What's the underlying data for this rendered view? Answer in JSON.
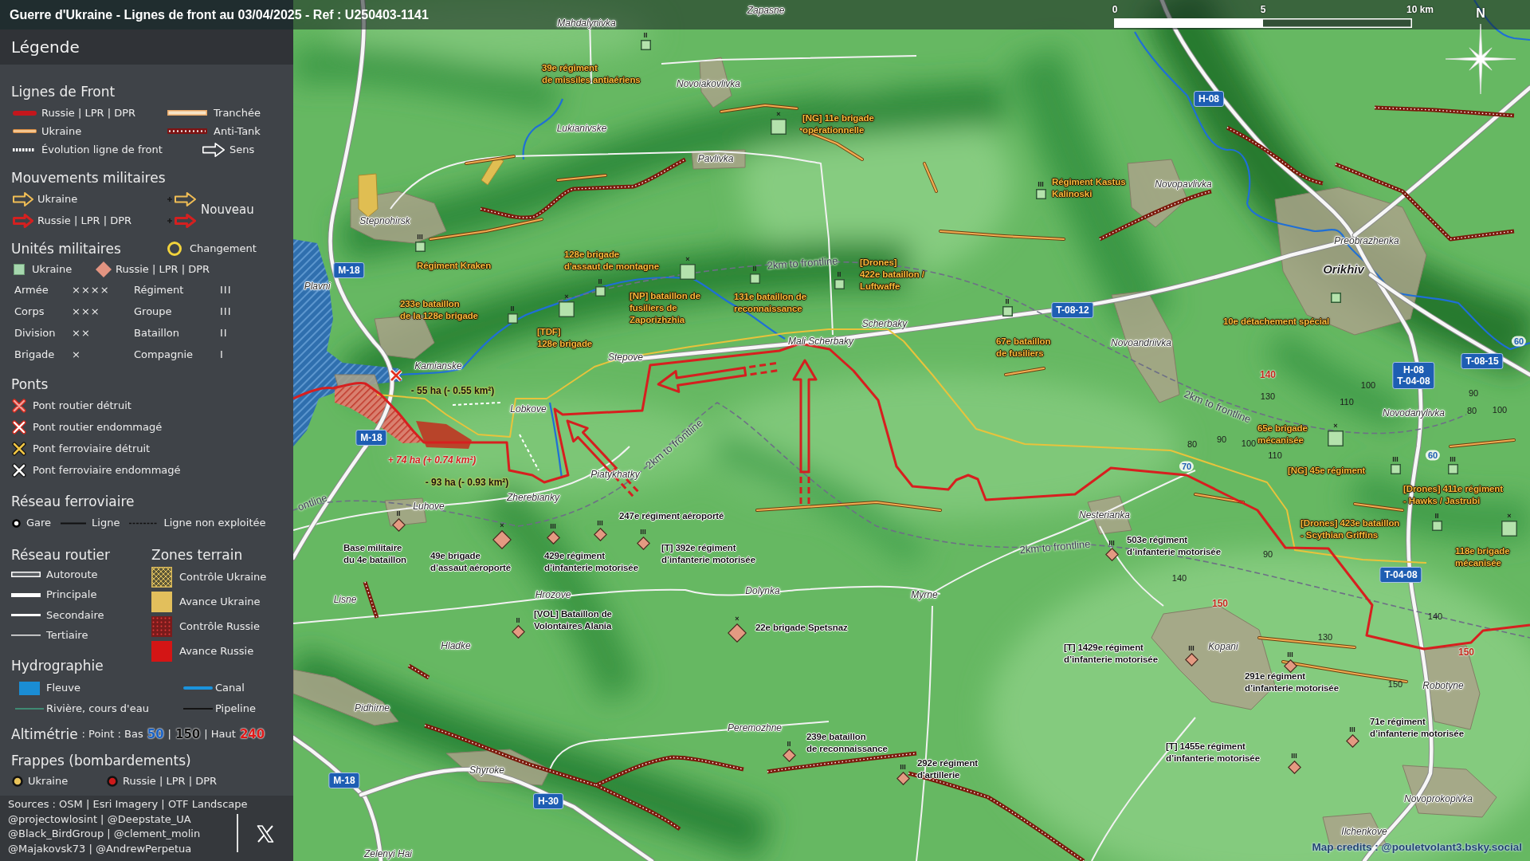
{
  "title": "Guerre d'Ukraine - Lignes de front au 03/04/2025 - Ref : U250403-1141",
  "legend": {
    "title": "Légende",
    "front_lines": {
      "heading": "Lignes de Front",
      "items": [
        {
          "kind": "russia_line",
          "label": "Russie | LPR | DPR"
        },
        {
          "kind": "trench",
          "label": "Tranchée"
        },
        {
          "kind": "ukraine_line",
          "label": "Ukraine"
        },
        {
          "kind": "antitank",
          "label": "Anti-Tank"
        },
        {
          "kind": "evolution",
          "label": "Évolution ligne de front"
        },
        {
          "kind": "direction",
          "label": "Sens"
        }
      ]
    },
    "movements": {
      "heading": "Mouvements militaires",
      "items": [
        {
          "kind": "ukraine",
          "label": "Ukraine"
        },
        {
          "kind": "russia",
          "label": "Russie | LPR | DPR"
        }
      ],
      "new_label": "Nouveau"
    },
    "units": {
      "heading": "Unités militaires",
      "change_label": "Changement",
      "sides": [
        {
          "kind": "ukraine",
          "label": "Ukraine"
        },
        {
          "kind": "russia",
          "label": "Russie | LPR | DPR"
        }
      ],
      "echelons": [
        {
          "name": "Armée",
          "mark": "××××"
        },
        {
          "name": "Régiment",
          "mark": "III"
        },
        {
          "name": "Corps",
          "mark": "×××"
        },
        {
          "name": "Groupe",
          "mark": "III"
        },
        {
          "name": "Division",
          "mark": "××"
        },
        {
          "name": "Bataillon",
          "mark": "II"
        },
        {
          "name": "Brigade",
          "mark": "×"
        },
        {
          "name": "Compagnie",
          "mark": "I"
        }
      ]
    },
    "bridges": {
      "heading": "Ponts",
      "items": [
        {
          "kind": "road_destroyed",
          "label": "Pont routier détruit"
        },
        {
          "kind": "road_damaged",
          "label": "Pont routier endommagé"
        },
        {
          "kind": "rail_destroyed",
          "label": "Pont ferroviaire détruit"
        },
        {
          "kind": "rail_damaged",
          "label": "Pont ferroviaire endommagé"
        }
      ]
    },
    "railway": {
      "heading": "Réseau ferroviaire",
      "items": [
        {
          "kind": "station",
          "label": "Gare"
        },
        {
          "kind": "line",
          "label": "Ligne"
        },
        {
          "kind": "unused",
          "label": "Ligne non exploitée"
        }
      ]
    },
    "roads": {
      "heading": "Réseau routier",
      "items": [
        {
          "kind": "motorway",
          "label": "Autoroute"
        },
        {
          "kind": "primary",
          "label": "Principale"
        },
        {
          "kind": "secondary",
          "label": "Secondaire"
        },
        {
          "kind": "tertiary",
          "label": "Tertiaire"
        }
      ]
    },
    "zones": {
      "heading": "Zones terrain",
      "items": [
        {
          "kind": "ukraine_control",
          "label": "Contrôle Ukraine"
        },
        {
          "kind": "ukraine_advance",
          "label": "Avance Ukraine"
        },
        {
          "kind": "russia_control",
          "label": "Contrôle Russie"
        },
        {
          "kind": "russia_advance",
          "label": "Avance Russie"
        }
      ]
    },
    "hydrography": {
      "heading": "Hydrographie",
      "items": [
        {
          "kind": "river",
          "label": "Fleuve"
        },
        {
          "kind": "canal",
          "label": "Canal"
        },
        {
          "kind": "stream",
          "label": "Rivière, cours d'eau"
        },
        {
          "kind": "pipeline",
          "label": "Pipeline"
        }
      ]
    },
    "altimetry": {
      "heading": "Altimétrie",
      "parts": [
        {
          "kind": "text",
          "text": ": Point : Bas"
        },
        {
          "kind": "low",
          "text": "50"
        },
        {
          "kind": "text",
          "text": "|"
        },
        {
          "kind": "mid",
          "text": "150"
        },
        {
          "kind": "text",
          "text": "| Haut"
        },
        {
          "kind": "high",
          "text": "240"
        }
      ]
    },
    "strikes": {
      "heading": "Frappes (bombardements)",
      "items": [
        {
          "kind": "ukraine",
          "label": "Ukraine"
        },
        {
          "kind": "russia",
          "label": "Russie | LPR | DPR"
        }
      ]
    }
  },
  "sources": [
    "Sources : OSM | Esri Imagery | OTF Landscape",
    "@projectowlosint | @Deepstate_UA",
    "@Black_BirdGroup | @clement_molin",
    "@Majakovsk73 | @AndrewPerpetua"
  ],
  "map": {
    "scale": {
      "labels": [
        "0",
        "5",
        "10 km"
      ]
    },
    "north": "N",
    "places": [
      {
        "name": "Zapasne",
        "kind": "village"
      },
      {
        "name": "Mahdalynivka",
        "kind": "village"
      },
      {
        "name": "Novoiakovlivka",
        "kind": "village"
      },
      {
        "name": "Lukianivske",
        "kind": "village"
      },
      {
        "name": "Pavlivka",
        "kind": "village"
      },
      {
        "name": "Novopavlivka",
        "kind": "village"
      },
      {
        "name": "Stepnohirsk",
        "kind": "village"
      },
      {
        "name": "Preobrazhenka",
        "kind": "village"
      },
      {
        "name": "Orikhiv",
        "kind": "town"
      },
      {
        "name": "Plavni",
        "kind": "village"
      },
      {
        "name": "Scherbaky",
        "kind": "village"
      },
      {
        "name": "Mali Scherbaky",
        "kind": "village"
      },
      {
        "name": "Novoandriivka",
        "kind": "village"
      },
      {
        "name": "Stepove",
        "kind": "village"
      },
      {
        "name": "Kamianske",
        "kind": "village"
      },
      {
        "name": "Lobkove",
        "kind": "village"
      },
      {
        "name": "Novodanylivka",
        "kind": "village"
      },
      {
        "name": "Piatykhatky",
        "kind": "village"
      },
      {
        "name": "Zherebianky",
        "kind": "village"
      },
      {
        "name": "Luhove",
        "kind": "village"
      },
      {
        "name": "Nesterianka",
        "kind": "village"
      },
      {
        "name": "Lisne",
        "kind": "village"
      },
      {
        "name": "Hrozove",
        "kind": "village"
      },
      {
        "name": "Dolynka",
        "kind": "village"
      },
      {
        "name": "Myrne",
        "kind": "village"
      },
      {
        "name": "Hladke",
        "kind": "village"
      },
      {
        "name": "Kopani",
        "kind": "village"
      },
      {
        "name": "Robotyne",
        "kind": "village"
      },
      {
        "name": "Pidhirne",
        "kind": "village"
      },
      {
        "name": "Peremozhne",
        "kind": "village"
      },
      {
        "name": "Shyroke",
        "kind": "village"
      },
      {
        "name": "Novoprokopivka",
        "kind": "village"
      },
      {
        "name": "Ilchenkove",
        "kind": "village"
      },
      {
        "name": "Zelenyi Hai",
        "kind": "village"
      }
    ],
    "unit_markers": [
      {
        "kind": "ukraine_unit",
        "echelon": "II"
      },
      {
        "kind": "ukraine_brigade",
        "echelon": "×"
      },
      {
        "kind": "ukraine_unit",
        "echelon": "III"
      },
      {
        "kind": "ukraine_unit",
        "echelon": "III"
      },
      {
        "kind": "ukraine_brigade",
        "echelon": "×"
      },
      {
        "kind": "ukraine_unit",
        "echelon": "II"
      },
      {
        "kind": "ukraine_unit",
        "echelon": "II"
      },
      {
        "kind": "ukraine_unit",
        "echelon": "II"
      },
      {
        "kind": "ukraine_unit"
      },
      {
        "kind": "ukraine_unit",
        "echelon": "II"
      },
      {
        "kind": "ukraine_brigade",
        "echelon": "×"
      },
      {
        "kind": "ukraine_unit",
        "echelon": "II"
      },
      {
        "kind": "ukraine_brigade",
        "echelon": "×"
      },
      {
        "kind": "ukraine_unit",
        "echelon": "III"
      },
      {
        "kind": "ukraine_unit",
        "echelon": "III"
      },
      {
        "kind": "russia_unit",
        "echelon": "II"
      },
      {
        "kind": "russia_brigade",
        "echelon": "×"
      },
      {
        "kind": "russia_unit",
        "echelon": "III"
      },
      {
        "kind": "russia_unit",
        "echelon": "III"
      },
      {
        "kind": "ukraine_unit",
        "echelon": "II"
      },
      {
        "kind": "ukraine_brigade",
        "echelon": "×"
      },
      {
        "kind": "russia_unit",
        "echelon": "III"
      },
      {
        "kind": "russia_unit",
        "echelon": "III"
      },
      {
        "kind": "russia_unit",
        "echelon": "II"
      },
      {
        "kind": "russia_brigade",
        "echelon": "×"
      },
      {
        "kind": "russia_unit",
        "echelon": "III"
      },
      {
        "kind": "russia_unit",
        "echelon": "III"
      },
      {
        "kind": "russia_unit",
        "echelon": "III"
      },
      {
        "kind": "russia_unit",
        "echelon": "II"
      },
      {
        "kind": "russia_unit",
        "echelon": "III"
      },
      {
        "kind": "russia_unit",
        "echelon": "III"
      }
    ],
    "unit_labels": [
      {
        "kind": "ukraine",
        "text": "39e régiment\nde missiles antiaériens"
      },
      {
        "kind": "ukraine",
        "text": "[NG] 11e brigade\nopérationnelle"
      },
      {
        "kind": "ukraine",
        "text": "Régiment Kastus\nKalinoski"
      },
      {
        "kind": "ukraine",
        "text": "Régiment Kraken"
      },
      {
        "kind": "ukraine",
        "text": "128e brigade\nd'assaut de montagne"
      },
      {
        "kind": "ukraine",
        "text": "[Drones]\n422e bataillon /\nLuftwaffe"
      },
      {
        "kind": "ukraine",
        "text": "233e bataillon\nde la 128e brigade"
      },
      {
        "kind": "ukraine",
        "text": "[NP] bataillon de\nfusiliers de\nZaporizhzhia"
      },
      {
        "kind": "ukraine",
        "text": "131e bataillon de\nreconnaissance"
      },
      {
        "kind": "ukraine",
        "text": "10e détachement spécial"
      },
      {
        "kind": "ukraine",
        "text": "[TDF]\n128e brigade"
      },
      {
        "kind": "ukraine",
        "text": "67e bataillon\nde fusiliers"
      },
      {
        "kind": "ukraine",
        "text": "65e brigade\nmécanisée"
      },
      {
        "kind": "ukraine",
        "text": "[NG] 45e régiment"
      },
      {
        "kind": "ukraine",
        "text": "[Drones] 411e régiment\n- Hawks / Jastrubi"
      },
      {
        "kind": "russia",
        "text": "247e régiment aéroporté"
      },
      {
        "kind": "ukraine",
        "text": "[Drones] 423e bataillon\n- Scythian Griffins"
      },
      {
        "kind": "russia",
        "text": "Base militaire\ndu 4e bataillon"
      },
      {
        "kind": "russia",
        "text": "49e brigade\nd’assaut aéroporté"
      },
      {
        "kind": "russia",
        "text": "429e régiment\nd’infanterie motorisée"
      },
      {
        "kind": "russia",
        "text": "[T] 392e régiment\nd’infanterie motorisée"
      },
      {
        "kind": "russia",
        "text": "503e régiment\nd’infanterie motorisée"
      },
      {
        "kind": "ukraine",
        "text": "118e brigade\nmécanisée"
      },
      {
        "kind": "russia",
        "text": "[VOL] Bataillon de\nVolontaires Alania"
      },
      {
        "kind": "russia",
        "text": "22e brigade Spetsnaz"
      },
      {
        "kind": "russia",
        "text": "[T] 1429e régiment\nd’infanterie motorisée"
      },
      {
        "kind": "russia",
        "text": "291e régiment\nd’infanterie motorisée"
      },
      {
        "kind": "russia",
        "text": "71e régiment\nd’infanterie motorisée"
      },
      {
        "kind": "russia",
        "text": "239e bataillon\nde reconnaissance"
      },
      {
        "kind": "russia",
        "text": "[T] 1455e régiment\nd’infanterie motorisée"
      },
      {
        "kind": "russia",
        "text": "292e régiment\nd'artillerie"
      }
    ],
    "road_signs": [
      {
        "label": "H-08"
      },
      {
        "label": "M-18"
      },
      {
        "label": "T-08-12"
      },
      {
        "label": "H-08\nT-04-08"
      },
      {
        "label": "T-08-15"
      },
      {
        "label": "M-18"
      },
      {
        "label": "T-04-08"
      },
      {
        "label": "M-18"
      },
      {
        "label": "H-30"
      }
    ],
    "route_markers": [
      {
        "label": "60"
      },
      {
        "label": "60"
      },
      {
        "label": "70"
      }
    ],
    "elevations": [
      {
        "value": "140",
        "kind": "high"
      },
      {
        "value": "100",
        "kind": "spot"
      },
      {
        "value": "130",
        "kind": "spot"
      },
      {
        "value": "90",
        "kind": "spot"
      },
      {
        "value": "110",
        "kind": "spot"
      },
      {
        "value": "80",
        "kind": "spot"
      },
      {
        "value": "100",
        "kind": "spot"
      },
      {
        "value": "80",
        "kind": "spot"
      },
      {
        "value": "90",
        "kind": "spot"
      },
      {
        "value": "100",
        "kind": "spot"
      },
      {
        "value": "110",
        "kind": "spot"
      },
      {
        "value": "90",
        "kind": "spot"
      },
      {
        "value": "140",
        "kind": "spot"
      },
      {
        "value": "150",
        "kind": "high"
      },
      {
        "value": "140",
        "kind": "spot"
      },
      {
        "value": "130",
        "kind": "spot"
      },
      {
        "value": "150",
        "kind": "high"
      },
      {
        "value": "150",
        "kind": "spot"
      }
    ],
    "distance_labels": [
      "2km to frontline",
      "2km to frontline",
      "2km to frontline",
      "ontline",
      "2km to frontline"
    ],
    "area_changes": [
      {
        "kind": "loss",
        "text": "- 55 ha (- 0.55 km²)"
      },
      {
        "kind": "gain",
        "text": "+ 74 ha (+ 0.74 km²)"
      },
      {
        "kind": "loss",
        "text": "- 93 ha (- 0.93 km²)"
      }
    ],
    "credits": "Map credits : @pouletvolant3.bsky.social"
  }
}
